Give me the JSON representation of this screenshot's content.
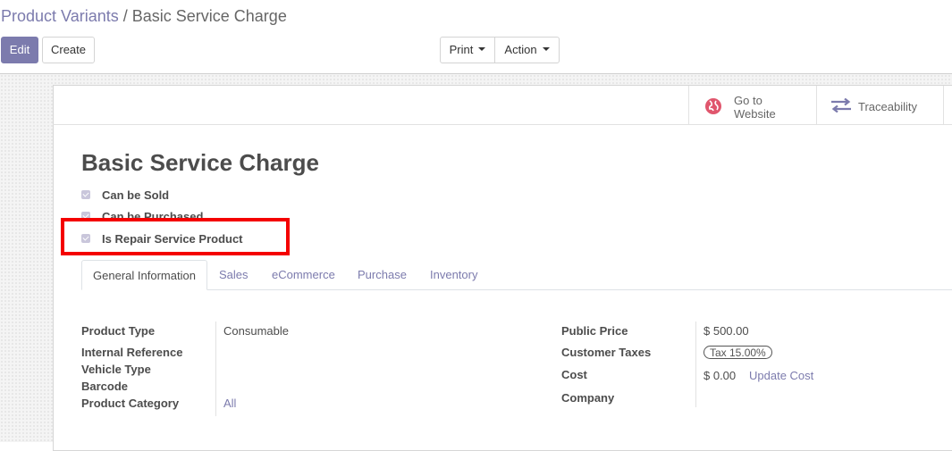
{
  "breadcrumb": {
    "parent": "Product Variants",
    "separator": "/",
    "current": "Basic Service Charge"
  },
  "buttons": {
    "edit": "Edit",
    "create": "Create",
    "print": "Print",
    "action": "Action"
  },
  "smart_buttons": {
    "website": {
      "line1": "Go to",
      "line2": "Website",
      "icon": "globe-icon",
      "icon_color": "#e0566d"
    },
    "traceability": {
      "label": "Traceability",
      "icon": "arrows-exchange-icon",
      "icon_color": "#7c7bad"
    }
  },
  "product": {
    "name": "Basic Service Charge",
    "checkboxes": [
      {
        "label": "Can be Sold",
        "checked": true
      },
      {
        "label": "Can be Purchased",
        "checked": true
      },
      {
        "label": "Is Repair Service Product",
        "checked": true
      }
    ]
  },
  "tabs": [
    "General Information",
    "Sales",
    "eCommerce",
    "Purchase",
    "Inventory"
  ],
  "fields_left": [
    {
      "label": "Product Type",
      "value": "Consumable"
    },
    {
      "label": "Internal Reference",
      "value": ""
    },
    {
      "label": "Vehicle Type",
      "value": ""
    },
    {
      "label": "Barcode",
      "value": ""
    },
    {
      "label": "Product Category",
      "value": "All"
    }
  ],
  "fields_right": {
    "public_price": {
      "label": "Public Price",
      "value": "$ 500.00"
    },
    "customer_taxes": {
      "label": "Customer Taxes",
      "value": "Tax 15.00%"
    },
    "cost": {
      "label": "Cost",
      "value": "$ 0.00",
      "action": "Update Cost"
    },
    "company": {
      "label": "Company",
      "value": ""
    }
  },
  "colors": {
    "accent": "#7c7bad",
    "highlight": "#f40000"
  }
}
